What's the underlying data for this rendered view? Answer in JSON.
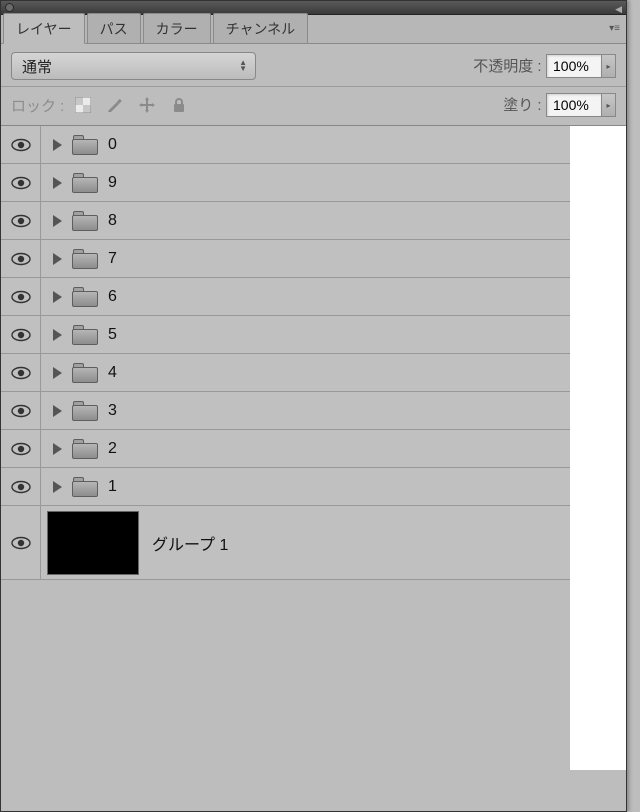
{
  "tabs": {
    "layers": "レイヤー",
    "paths": "パス",
    "color": "カラー",
    "channels": "チャンネル"
  },
  "blend": {
    "mode": "通常"
  },
  "opacity": {
    "label": "不透明度 :",
    "value": "100%"
  },
  "lock": {
    "label": "ロック :"
  },
  "fill": {
    "label": "塗り :",
    "value": "100%"
  },
  "layers": [
    {
      "name": "0"
    },
    {
      "name": "9"
    },
    {
      "name": "8"
    },
    {
      "name": "7"
    },
    {
      "name": "6"
    },
    {
      "name": "5"
    },
    {
      "name": "4"
    },
    {
      "name": "3"
    },
    {
      "name": "2"
    },
    {
      "name": "1"
    }
  ],
  "group_layer": {
    "name": "グループ 1"
  }
}
